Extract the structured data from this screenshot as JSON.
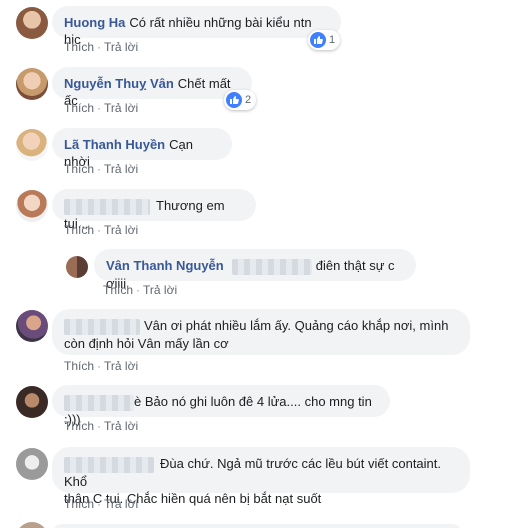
{
  "actions": {
    "like": "Thích",
    "reply": "Trả lời"
  },
  "comments": [
    {
      "name": "Huong Ha",
      "text": "Có rất nhiều những bài kiểu ntn hic",
      "reactions": "1"
    },
    {
      "name": "Nguyễn Thuỵ Vân",
      "text": "Chết mất ấc",
      "reactions": "2"
    },
    {
      "name": "Lã Thanh Huyền",
      "text": "Cạn nhời"
    },
    {
      "text": "Thương em tui..."
    },
    {
      "name": "Vân Thanh Nguyễn",
      "text": "điên thật sự c ơiiii"
    },
    {
      "text_line1": "Vân ơi phát nhiều lắm ấy. Quảng cáo khắp nơi, mình",
      "text_line2": "còn định hỏi Vân mấy lần cơ"
    },
    {
      "text": "è Bảo nó ghi luôn đê 4 lửa.... cho mng tin :)))"
    },
    {
      "text_line1": "Đùa chứ. Ngả mũ trước các lều bút viết containt. Khổ",
      "text_line2": "thân C tui. Chắc hiền quá nên bị bắt nạt suốt"
    }
  ],
  "colors": {
    "name": "#385898",
    "bubble": "#f2f3f5",
    "action": "#606770",
    "like": "#4080ff"
  }
}
